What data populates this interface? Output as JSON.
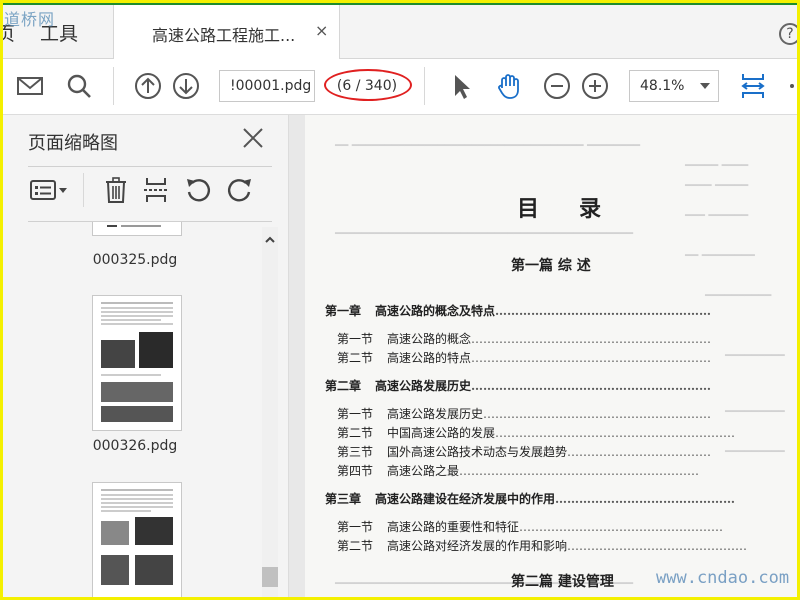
{
  "watermark_top": "道桥网",
  "watermark_bottom": "www.cndao.com",
  "tabs": {
    "left_partial": "页",
    "tools": "工具",
    "document": "高速公路工程施工...",
    "close": "×",
    "help": "?"
  },
  "toolbar": {
    "page_field": "!00001.pdg",
    "page_count": "(6 / 340)",
    "zoom": "48.1%",
    "icons": [
      "mail-icon",
      "search-icon",
      "previous-page-icon",
      "next-page-icon",
      "select-arrow-icon",
      "hand-tool-icon",
      "zoom-out-icon",
      "zoom-in-icon",
      "fit-page-icon",
      "more-icon"
    ],
    "accent_color": "#1a6fc9"
  },
  "sidebar": {
    "title": "页面缩略图",
    "thumbnails": [
      {
        "label": "000325.pdg"
      },
      {
        "label": "000326.pdg"
      },
      {
        "label": ""
      }
    ]
  },
  "document": {
    "heading": "目录",
    "parts": [
      "第一篇  综    述",
      "第二篇  建设管理"
    ],
    "toc": [
      {
        "num": "第一章",
        "title": "高速公路的概念及特点",
        "chapter": true
      },
      {
        "num": "第一节",
        "title": "高速公路的概念",
        "chapter": false
      },
      {
        "num": "第二节",
        "title": "高速公路的特点",
        "chapter": false
      },
      {
        "num": "第二章",
        "title": "高速公路发展历史",
        "chapter": true
      },
      {
        "num": "第一节",
        "title": "高速公路发展历史",
        "chapter": false
      },
      {
        "num": "第二节",
        "title": "中国高速公路的发展",
        "chapter": false
      },
      {
        "num": "第三节",
        "title": "国外高速公路技术动态与发展趋势",
        "chapter": false
      },
      {
        "num": "第四节",
        "title": "高速公路之最",
        "chapter": false
      },
      {
        "num": "第三章",
        "title": "高速公路建设在经济发展中的作用",
        "chapter": true
      },
      {
        "num": "第一节",
        "title": "高速公路的重要性和特征",
        "chapter": false
      },
      {
        "num": "第二节",
        "title": "高速公路对经济发展的作用和影响",
        "chapter": false
      }
    ]
  }
}
